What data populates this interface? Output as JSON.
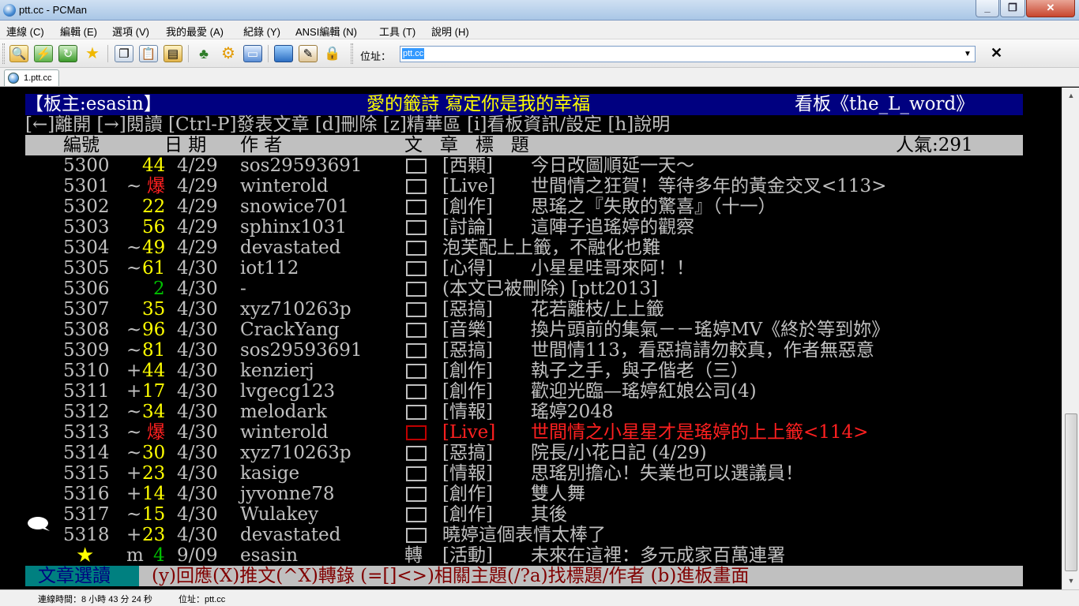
{
  "window": {
    "title": "ptt.cc - PCMan",
    "min": "_",
    "max": "❐",
    "close": "✕"
  },
  "menu": [
    "連線 (C)",
    "編輯 (E)",
    "選項 (V)",
    "我的最愛 (A)",
    "紀錄 (Y)",
    "ANSI編輯 (N)",
    "工具 (T)",
    "說明 (H)"
  ],
  "toolbar": {
    "icons": [
      "connect-icon",
      "quick-connect-icon",
      "reconnect-icon",
      "favorites-icon",
      "copy-icon",
      "paste-icon",
      "copy-with-color-icon",
      "font-icon",
      "settings-icon",
      "ansi-editor-icon",
      "picture-icon",
      "emoticon-icon",
      "lock-icon"
    ],
    "address_label": "位址：",
    "address_value": "ptt.cc",
    "dropdown_glyph": "▼",
    "close_glyph": "✕"
  },
  "tabs": [
    {
      "label": "1.ptt.cc"
    }
  ],
  "terminal": {
    "header": {
      "moderator": "【板主:esasin】",
      "board_title": "愛的籤詩 寫定你是我的幸福",
      "board_name": "看板《the_L_word》"
    },
    "help_line": "[←]離開 [→]閱讀 [Ctrl-P]發表文章 [d]刪除 [z]精華區 [i]看板資訊/設定 [h]說明",
    "columns": {
      "num": "編號",
      "date": "日 期",
      "author": "作 者",
      "title": "文   章   標   題",
      "popularity": "人氣:291"
    },
    "colors": {
      "green": "#00c000",
      "yellow": "#ffff00",
      "red": "#ff2020",
      "white": "#c0c0c0",
      "bright_white": "#ffffff",
      "dark_red": "#c00000"
    },
    "rows": [
      {
        "num": "5300",
        "mark": "",
        "push": "44",
        "push_color": "#ffff00",
        "date": "4/29",
        "author": "sos29593691",
        "tag": "[西顆]",
        "title": "今日改圖順延一天～",
        "selected": false
      },
      {
        "num": "5301",
        "mark": "~",
        "push": "爆",
        "push_color": "#ff2020",
        "date": "4/29",
        "author": "winterold",
        "tag": "[Live]",
        "title": "世間情之狂賀！等待多年的黃金交叉<113>",
        "selected": false
      },
      {
        "num": "5302",
        "mark": "",
        "push": "22",
        "push_color": "#ffff00",
        "date": "4/29",
        "author": "snowice701",
        "tag": "[創作]",
        "title": "思瑤之『失敗的驚喜』（十一）",
        "selected": false
      },
      {
        "num": "5303",
        "mark": "",
        "push": "56",
        "push_color": "#ffff00",
        "date": "4/29",
        "author": "sphinx1031",
        "tag": "[討論]",
        "title": "這陣子追瑤婷的觀察",
        "selected": false
      },
      {
        "num": "5304",
        "mark": "~",
        "push": "49",
        "push_color": "#ffff00",
        "date": "4/29",
        "author": "devastated",
        "tag": "",
        "title": "泡芙配上上籤，不融化也難",
        "selected": false
      },
      {
        "num": "5305",
        "mark": "~",
        "push": "61",
        "push_color": "#ffff00",
        "date": "4/30",
        "author": "iot112",
        "tag": "[心得]",
        "title": "小星星哇哥來阿！！",
        "selected": false
      },
      {
        "num": "5306",
        "mark": "",
        "push": "2",
        "push_color": "#00c000",
        "date": "4/30",
        "author": "-",
        "tag": "",
        "title": "(本文已被刪除) [ptt2013]",
        "selected": false
      },
      {
        "num": "5307",
        "mark": "",
        "push": "35",
        "push_color": "#ffff00",
        "date": "4/30",
        "author": "xyz710263p",
        "tag": "[惡搞]",
        "title": "花若離枝/上上籤",
        "selected": false
      },
      {
        "num": "5308",
        "mark": "~",
        "push": "96",
        "push_color": "#ffff00",
        "date": "4/30",
        "author": "CrackYang",
        "tag": "[音樂]",
        "title": "換片頭前的集氣－－瑤婷MV《終於等到妳》",
        "selected": false
      },
      {
        "num": "5309",
        "mark": "~",
        "push": "81",
        "push_color": "#ffff00",
        "date": "4/30",
        "author": "sos29593691",
        "tag": "[惡搞]",
        "title": "世間情113，看惡搞請勿較真，作者無惡意",
        "selected": false
      },
      {
        "num": "5310",
        "mark": "+",
        "push": "44",
        "push_color": "#ffff00",
        "date": "4/30",
        "author": "kenzierj",
        "tag": "[創作]",
        "title": "執子之手，與子偕老（三）",
        "selected": false
      },
      {
        "num": "5311",
        "mark": "+",
        "push": "17",
        "push_color": "#ffff00",
        "date": "4/30",
        "author": "lvgecg123",
        "tag": "[創作]",
        "title": "歡迎光臨—瑤婷紅娘公司(4)",
        "selected": false
      },
      {
        "num": "5312",
        "mark": "~",
        "push": "34",
        "push_color": "#ffff00",
        "date": "4/30",
        "author": "melodark",
        "tag": "[情報]",
        "title": "瑤婷2048",
        "selected": false
      },
      {
        "num": "5313",
        "mark": "~",
        "push": "爆",
        "push_color": "#ff2020",
        "date": "4/30",
        "author": "winterold",
        "tag": "[Live]",
        "title": "世間情之小星星才是瑤婷的上上籤<114>",
        "selected": true
      },
      {
        "num": "5314",
        "mark": "~",
        "push": "30",
        "push_color": "#ffff00",
        "date": "4/30",
        "author": "xyz710263p",
        "tag": "[惡搞]",
        "title": "院長/小花日記 (4/29)",
        "selected": false
      },
      {
        "num": "5315",
        "mark": "+",
        "push": "23",
        "push_color": "#ffff00",
        "date": "4/30",
        "author": "kasige",
        "tag": "[情報]",
        "title": "思瑤別擔心！失業也可以選議員！",
        "selected": false
      },
      {
        "num": "5316",
        "mark": "+",
        "push": "14",
        "push_color": "#ffff00",
        "date": "4/30",
        "author": "jyvonne78",
        "tag": "[創作]",
        "title": "雙人舞",
        "selected": false
      },
      {
        "num": "5317",
        "mark": "~",
        "push": "15",
        "push_color": "#ffff00",
        "date": "4/30",
        "author": "Wulakey",
        "tag": "[創作]",
        "title": "其後",
        "selected": false
      },
      {
        "num": "5318",
        "mark": "+",
        "push": "23",
        "push_color": "#ffff00",
        "date": "4/30",
        "author": "devastated",
        "tag": "",
        "title": "曉婷這個表情太棒了",
        "selected": false
      },
      {
        "num": "★",
        "mark": "m",
        "push": "4",
        "push_color": "#00c000",
        "date": "9/09",
        "author": "esasin",
        "tag": "[活動]",
        "title": "未來在這裡：多元成家百萬連署",
        "selected": false,
        "prefix": "轉",
        "pinned": true
      }
    ],
    "footer": {
      "mode": "文章選讀",
      "help": "(y)回應(X)推文(^X)轉錄 (=[]<>)相關主題(/?a)找標題/作者 (b)進板畫面"
    }
  },
  "status": {
    "connection_time": "連線時間：8 小時 43 分 24 秒",
    "address": "位址：ptt.cc"
  }
}
